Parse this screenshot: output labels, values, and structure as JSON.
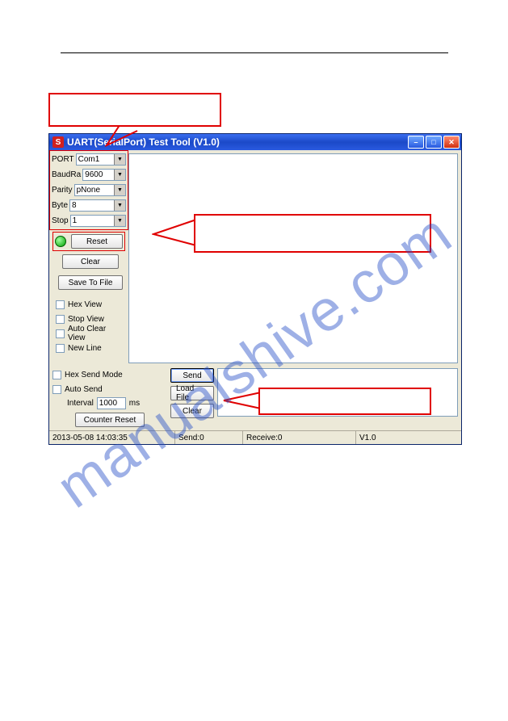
{
  "watermark": "manualshive.com",
  "window": {
    "title": "UART(SerialPort) Test Tool (V1.0)",
    "icon_letter": "S"
  },
  "port_panel": {
    "port_label": "PORT",
    "port_value": "Com1",
    "baud_label": "BaudRa",
    "baud_value": "9600",
    "parity_label": "Parity",
    "parity_value": "pNone",
    "byte_label": "Byte",
    "byte_value": "8",
    "stop_label": "Stop",
    "stop_value": "1"
  },
  "controls": {
    "reset": "Reset",
    "clear": "Clear",
    "save_to_file": "Save To File",
    "hex_view": "Hex View",
    "stop_view": "Stop View",
    "auto_clear_view": "Auto Clear View",
    "new_line": "New Line"
  },
  "send_panel": {
    "hex_send_mode": "Hex Send Mode",
    "auto_send": "Auto Send",
    "interval_label": "Interval",
    "interval_value": "1000",
    "interval_unit": "ms",
    "counter_reset": "Counter Reset",
    "send": "Send",
    "load_file": "Load File",
    "clear": "Clear"
  },
  "statusbar": {
    "datetime": "2013-05-08 14:03:35",
    "send_count": "Send:0",
    "receive_count": "Receive:0",
    "version": "V1.0"
  }
}
